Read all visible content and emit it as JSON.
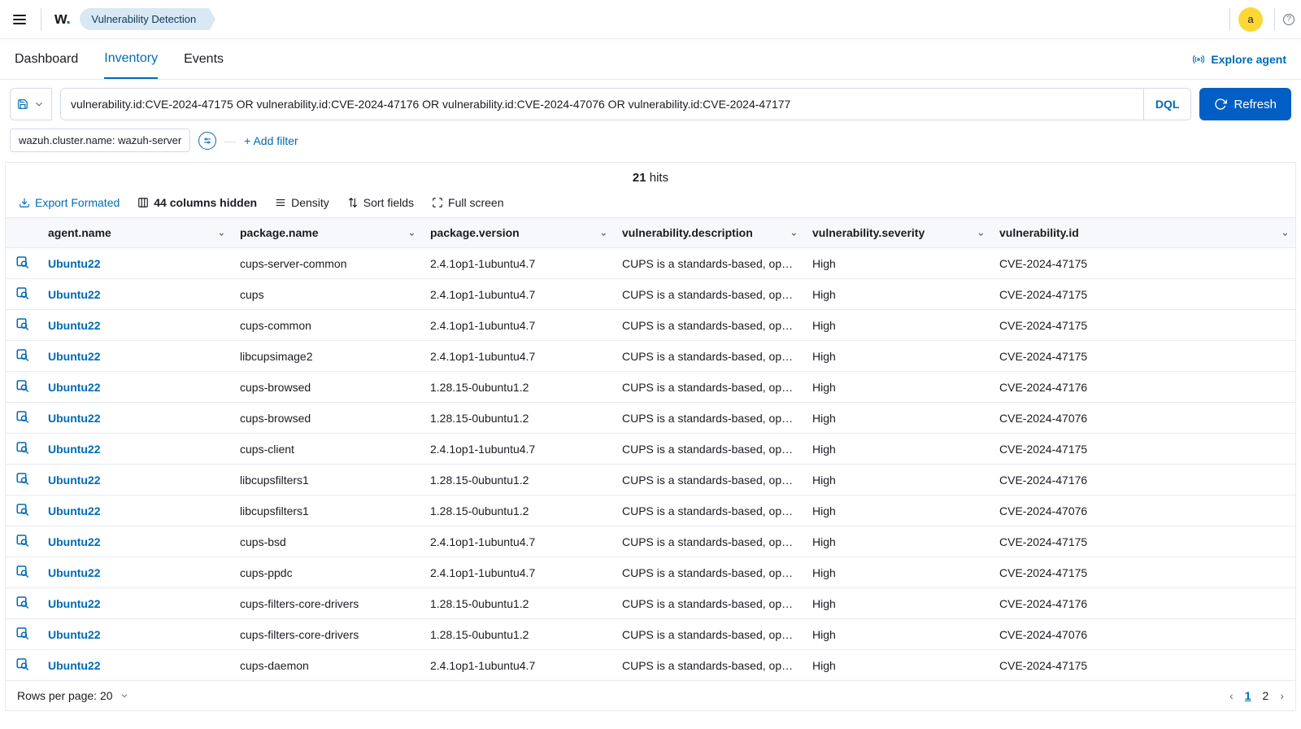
{
  "header": {
    "breadcrumb": "Vulnerability Detection",
    "avatar_initial": "a"
  },
  "tabs": {
    "items": [
      "Dashboard",
      "Inventory",
      "Events"
    ],
    "active": 1,
    "explore": "Explore agent"
  },
  "search": {
    "query": "vulnerability.id:CVE-2024-47175 OR vulnerability.id:CVE-2024-47176 OR vulnerability.id:CVE-2024-47076 OR vulnerability.id:CVE-2024-47177",
    "dql": "DQL",
    "refresh": "Refresh"
  },
  "filters": {
    "chip": "wazuh.cluster.name: wazuh-server",
    "add": "+ Add filter"
  },
  "hits": {
    "count": "21",
    "label": " hits"
  },
  "toolbar": {
    "export": "Export Formated",
    "columns_hidden": "44 columns hidden",
    "density": "Density",
    "sort": "Sort fields",
    "fullscreen": "Full screen"
  },
  "columns": [
    "agent.name",
    "package.name",
    "package.version",
    "vulnerability.description",
    "vulnerability.severity",
    "vulnerability.id"
  ],
  "rows": [
    {
      "agent": "Ubuntu22",
      "pkg": "cups-server-common",
      "ver": "2.4.1op1-1ubuntu4.7",
      "desc": "CUPS is a standards-based, op…",
      "sev": "High",
      "vid": "CVE-2024-47175"
    },
    {
      "agent": "Ubuntu22",
      "pkg": "cups",
      "ver": "2.4.1op1-1ubuntu4.7",
      "desc": "CUPS is a standards-based, op…",
      "sev": "High",
      "vid": "CVE-2024-47175"
    },
    {
      "agent": "Ubuntu22",
      "pkg": "cups-common",
      "ver": "2.4.1op1-1ubuntu4.7",
      "desc": "CUPS is a standards-based, op…",
      "sev": "High",
      "vid": "CVE-2024-47175"
    },
    {
      "agent": "Ubuntu22",
      "pkg": "libcupsimage2",
      "ver": "2.4.1op1-1ubuntu4.7",
      "desc": "CUPS is a standards-based, op…",
      "sev": "High",
      "vid": "CVE-2024-47175"
    },
    {
      "agent": "Ubuntu22",
      "pkg": "cups-browsed",
      "ver": "1.28.15-0ubuntu1.2",
      "desc": "CUPS is a standards-based, op…",
      "sev": "High",
      "vid": "CVE-2024-47176"
    },
    {
      "agent": "Ubuntu22",
      "pkg": "cups-browsed",
      "ver": "1.28.15-0ubuntu1.2",
      "desc": "CUPS is a standards-based, op…",
      "sev": "High",
      "vid": "CVE-2024-47076"
    },
    {
      "agent": "Ubuntu22",
      "pkg": "cups-client",
      "ver": "2.4.1op1-1ubuntu4.7",
      "desc": "CUPS is a standards-based, op…",
      "sev": "High",
      "vid": "CVE-2024-47175"
    },
    {
      "agent": "Ubuntu22",
      "pkg": "libcupsfilters1",
      "ver": "1.28.15-0ubuntu1.2",
      "desc": "CUPS is a standards-based, op…",
      "sev": "High",
      "vid": "CVE-2024-47176"
    },
    {
      "agent": "Ubuntu22",
      "pkg": "libcupsfilters1",
      "ver": "1.28.15-0ubuntu1.2",
      "desc": "CUPS is a standards-based, op…",
      "sev": "High",
      "vid": "CVE-2024-47076"
    },
    {
      "agent": "Ubuntu22",
      "pkg": "cups-bsd",
      "ver": "2.4.1op1-1ubuntu4.7",
      "desc": "CUPS is a standards-based, op…",
      "sev": "High",
      "vid": "CVE-2024-47175"
    },
    {
      "agent": "Ubuntu22",
      "pkg": "cups-ppdc",
      "ver": "2.4.1op1-1ubuntu4.7",
      "desc": "CUPS is a standards-based, op…",
      "sev": "High",
      "vid": "CVE-2024-47175"
    },
    {
      "agent": "Ubuntu22",
      "pkg": "cups-filters-core-drivers",
      "ver": "1.28.15-0ubuntu1.2",
      "desc": "CUPS is a standards-based, op…",
      "sev": "High",
      "vid": "CVE-2024-47176"
    },
    {
      "agent": "Ubuntu22",
      "pkg": "cups-filters-core-drivers",
      "ver": "1.28.15-0ubuntu1.2",
      "desc": "CUPS is a standards-based, op…",
      "sev": "High",
      "vid": "CVE-2024-47076"
    },
    {
      "agent": "Ubuntu22",
      "pkg": "cups-daemon",
      "ver": "2.4.1op1-1ubuntu4.7",
      "desc": "CUPS is a standards-based, op…",
      "sev": "High",
      "vid": "CVE-2024-47175"
    }
  ],
  "pager": {
    "rpp_label": "Rows per page: 20",
    "pages": [
      "1",
      "2"
    ],
    "active": 0
  }
}
